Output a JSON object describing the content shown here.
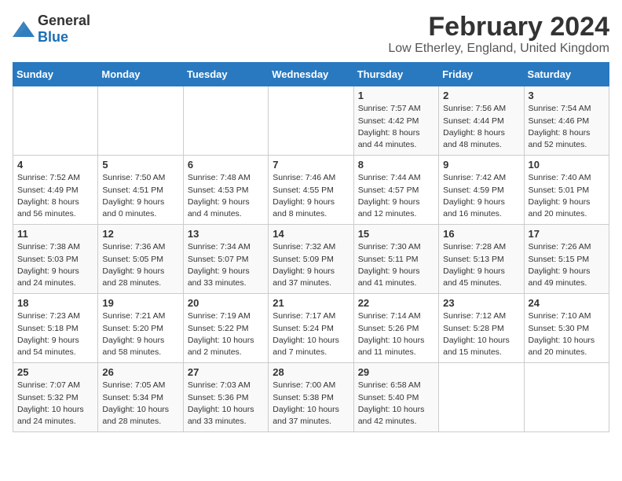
{
  "header": {
    "logo_general": "General",
    "logo_blue": "Blue",
    "title": "February 2024",
    "subtitle": "Low Etherley, England, United Kingdom"
  },
  "columns": [
    "Sunday",
    "Monday",
    "Tuesday",
    "Wednesday",
    "Thursday",
    "Friday",
    "Saturday"
  ],
  "weeks": [
    [
      {
        "day": "",
        "info": ""
      },
      {
        "day": "",
        "info": ""
      },
      {
        "day": "",
        "info": ""
      },
      {
        "day": "",
        "info": ""
      },
      {
        "day": "1",
        "info": "Sunrise: 7:57 AM\nSunset: 4:42 PM\nDaylight: 8 hours\nand 44 minutes."
      },
      {
        "day": "2",
        "info": "Sunrise: 7:56 AM\nSunset: 4:44 PM\nDaylight: 8 hours\nand 48 minutes."
      },
      {
        "day": "3",
        "info": "Sunrise: 7:54 AM\nSunset: 4:46 PM\nDaylight: 8 hours\nand 52 minutes."
      }
    ],
    [
      {
        "day": "4",
        "info": "Sunrise: 7:52 AM\nSunset: 4:49 PM\nDaylight: 8 hours\nand 56 minutes."
      },
      {
        "day": "5",
        "info": "Sunrise: 7:50 AM\nSunset: 4:51 PM\nDaylight: 9 hours\nand 0 minutes."
      },
      {
        "day": "6",
        "info": "Sunrise: 7:48 AM\nSunset: 4:53 PM\nDaylight: 9 hours\nand 4 minutes."
      },
      {
        "day": "7",
        "info": "Sunrise: 7:46 AM\nSunset: 4:55 PM\nDaylight: 9 hours\nand 8 minutes."
      },
      {
        "day": "8",
        "info": "Sunrise: 7:44 AM\nSunset: 4:57 PM\nDaylight: 9 hours\nand 12 minutes."
      },
      {
        "day": "9",
        "info": "Sunrise: 7:42 AM\nSunset: 4:59 PM\nDaylight: 9 hours\nand 16 minutes."
      },
      {
        "day": "10",
        "info": "Sunrise: 7:40 AM\nSunset: 5:01 PM\nDaylight: 9 hours\nand 20 minutes."
      }
    ],
    [
      {
        "day": "11",
        "info": "Sunrise: 7:38 AM\nSunset: 5:03 PM\nDaylight: 9 hours\nand 24 minutes."
      },
      {
        "day": "12",
        "info": "Sunrise: 7:36 AM\nSunset: 5:05 PM\nDaylight: 9 hours\nand 28 minutes."
      },
      {
        "day": "13",
        "info": "Sunrise: 7:34 AM\nSunset: 5:07 PM\nDaylight: 9 hours\nand 33 minutes."
      },
      {
        "day": "14",
        "info": "Sunrise: 7:32 AM\nSunset: 5:09 PM\nDaylight: 9 hours\nand 37 minutes."
      },
      {
        "day": "15",
        "info": "Sunrise: 7:30 AM\nSunset: 5:11 PM\nDaylight: 9 hours\nand 41 minutes."
      },
      {
        "day": "16",
        "info": "Sunrise: 7:28 AM\nSunset: 5:13 PM\nDaylight: 9 hours\nand 45 minutes."
      },
      {
        "day": "17",
        "info": "Sunrise: 7:26 AM\nSunset: 5:15 PM\nDaylight: 9 hours\nand 49 minutes."
      }
    ],
    [
      {
        "day": "18",
        "info": "Sunrise: 7:23 AM\nSunset: 5:18 PM\nDaylight: 9 hours\nand 54 minutes."
      },
      {
        "day": "19",
        "info": "Sunrise: 7:21 AM\nSunset: 5:20 PM\nDaylight: 9 hours\nand 58 minutes."
      },
      {
        "day": "20",
        "info": "Sunrise: 7:19 AM\nSunset: 5:22 PM\nDaylight: 10 hours\nand 2 minutes."
      },
      {
        "day": "21",
        "info": "Sunrise: 7:17 AM\nSunset: 5:24 PM\nDaylight: 10 hours\nand 7 minutes."
      },
      {
        "day": "22",
        "info": "Sunrise: 7:14 AM\nSunset: 5:26 PM\nDaylight: 10 hours\nand 11 minutes."
      },
      {
        "day": "23",
        "info": "Sunrise: 7:12 AM\nSunset: 5:28 PM\nDaylight: 10 hours\nand 15 minutes."
      },
      {
        "day": "24",
        "info": "Sunrise: 7:10 AM\nSunset: 5:30 PM\nDaylight: 10 hours\nand 20 minutes."
      }
    ],
    [
      {
        "day": "25",
        "info": "Sunrise: 7:07 AM\nSunset: 5:32 PM\nDaylight: 10 hours\nand 24 minutes."
      },
      {
        "day": "26",
        "info": "Sunrise: 7:05 AM\nSunset: 5:34 PM\nDaylight: 10 hours\nand 28 minutes."
      },
      {
        "day": "27",
        "info": "Sunrise: 7:03 AM\nSunset: 5:36 PM\nDaylight: 10 hours\nand 33 minutes."
      },
      {
        "day": "28",
        "info": "Sunrise: 7:00 AM\nSunset: 5:38 PM\nDaylight: 10 hours\nand 37 minutes."
      },
      {
        "day": "29",
        "info": "Sunrise: 6:58 AM\nSunset: 5:40 PM\nDaylight: 10 hours\nand 42 minutes."
      },
      {
        "day": "",
        "info": ""
      },
      {
        "day": "",
        "info": ""
      }
    ]
  ]
}
